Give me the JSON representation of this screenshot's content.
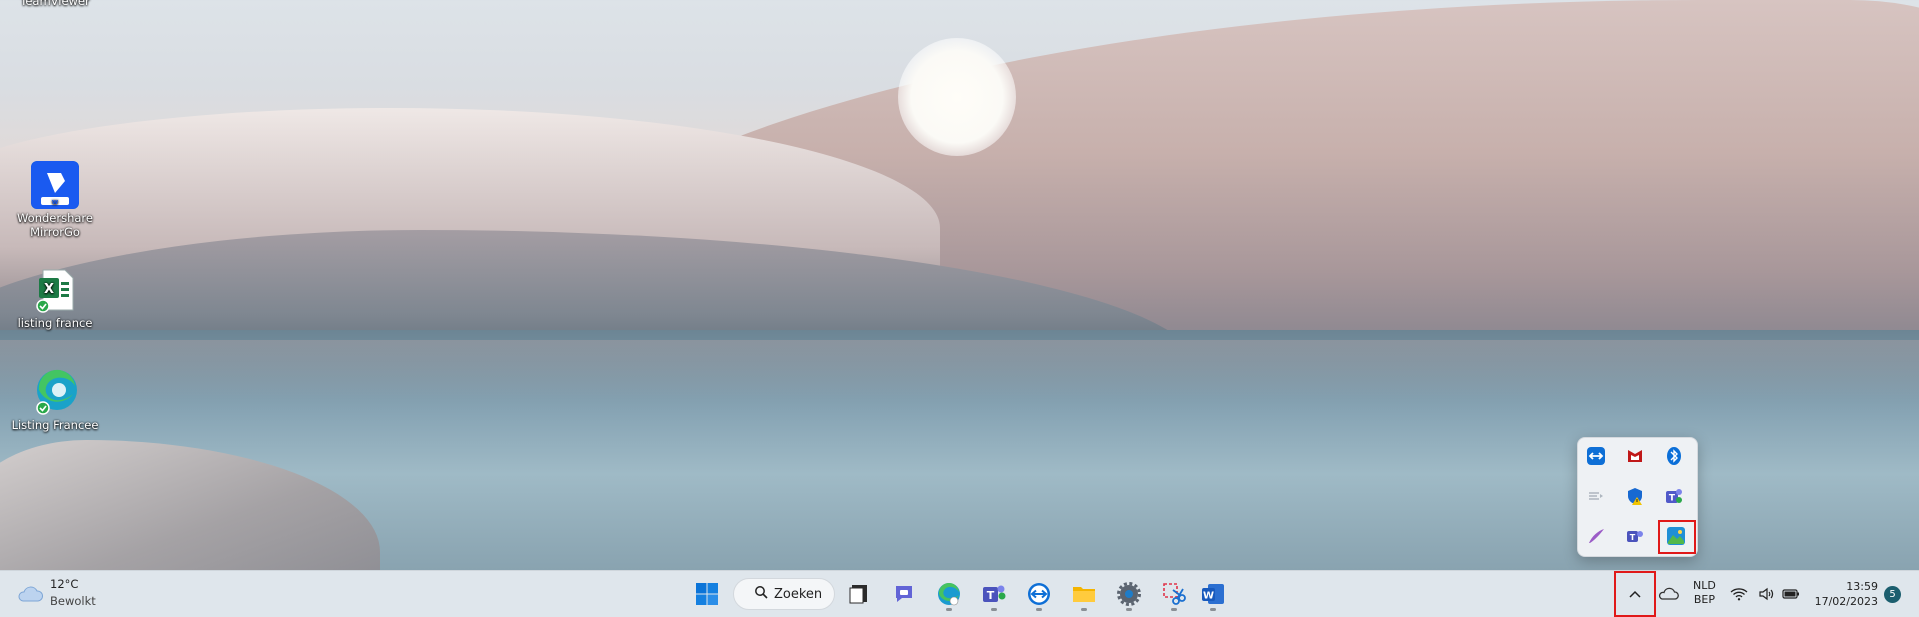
{
  "desktop": {
    "icons": [
      {
        "label": "TeamViewer"
      },
      {
        "label": "Wondershare MirrorGo"
      },
      {
        "label": "listing france"
      },
      {
        "label": "Listing Francee"
      }
    ]
  },
  "taskbar": {
    "weather": {
      "temp": "12°C",
      "condition": "Bewolkt"
    },
    "search_label": "Zoeken",
    "language": {
      "lang": "NLD",
      "layout": "BEP"
    },
    "clock": {
      "time": "13:59",
      "date": "17/02/2023"
    },
    "notification_count": "5",
    "pinned": [
      {
        "name": "start-button"
      },
      {
        "name": "task-view-button"
      },
      {
        "name": "chat-button"
      },
      {
        "name": "edge-button"
      },
      {
        "name": "teams-button"
      },
      {
        "name": "teamviewer-button"
      },
      {
        "name": "file-explorer-button"
      },
      {
        "name": "settings-button"
      },
      {
        "name": "snipping-tool-button"
      },
      {
        "name": "word-button"
      }
    ]
  },
  "tray_flyout": {
    "icons": [
      "teamviewer-icon",
      "mcafee-icon",
      "bluetooth-icon",
      "audio-device-icon",
      "security-warning-icon",
      "teams-icon",
      "quill-icon",
      "teams-classic-icon",
      "photo-app-icon"
    ]
  },
  "colors": {
    "highlight": "#e01919",
    "taskbar": "#dfe6ec",
    "accent": "#0067c0"
  }
}
